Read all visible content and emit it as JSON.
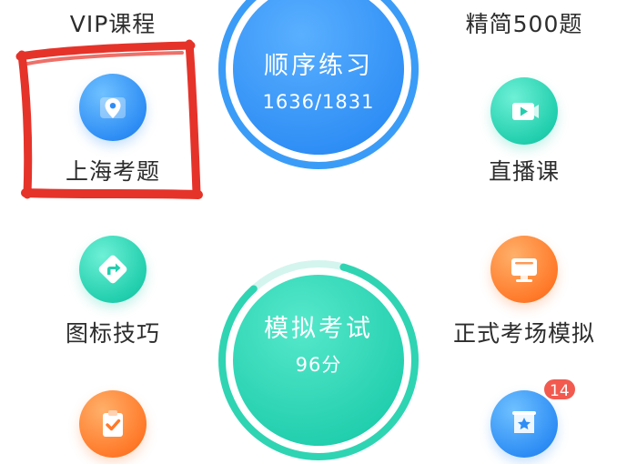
{
  "menu": {
    "vip": {
      "label": "VIP课程",
      "icon": "crown-icon"
    },
    "jingjian": {
      "label": "精简500题",
      "icon": "book-icon"
    },
    "shanghai": {
      "label": "上海考题",
      "icon": "location-pin-icon"
    },
    "zhibo": {
      "label": "直播课",
      "icon": "video-play-icon"
    },
    "jiqiao": {
      "label": "图标技巧",
      "icon": "direction-sign-icon"
    },
    "kaochang": {
      "label": "正式考场模拟",
      "icon": "monitor-icon"
    },
    "cuoti": {
      "label": "",
      "icon": "clipboard-check-icon"
    },
    "shoucang": {
      "label": "",
      "icon": "star-board-icon",
      "badge": "14"
    }
  },
  "practice": {
    "title": "顺序练习",
    "progress": "1636/1831",
    "progress_fraction": 0.8935
  },
  "exam": {
    "title": "模拟考试",
    "score": "96分"
  },
  "colors": {
    "blue": "#2f8ef5",
    "teal": "#22cfae",
    "orange": "#ff7a2a",
    "annotation_red": "#e5332a",
    "badge_red": "#f25a4f"
  }
}
